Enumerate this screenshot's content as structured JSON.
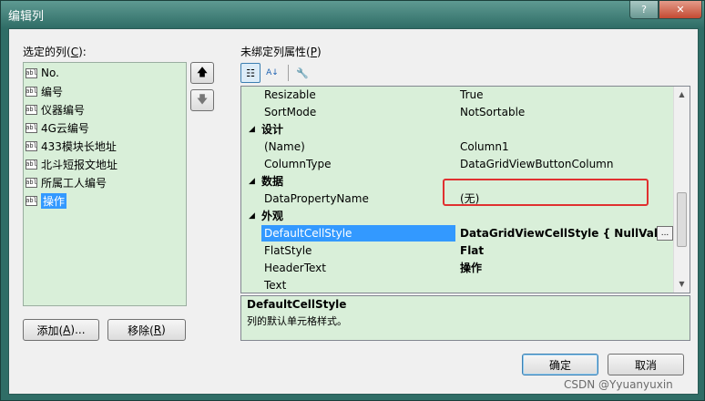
{
  "window": {
    "title": "编辑列",
    "help_glyph": "?",
    "close_glyph": "✕"
  },
  "left": {
    "label": "选定的列(",
    "label_mnemonic": "C",
    "label_suffix": "):",
    "icon_text": "abl",
    "items": [
      "No.",
      "编号",
      "仪器编号",
      "4G云编号",
      "433模块长地址",
      "北斗短报文地址",
      "所属工人编号",
      "操作"
    ],
    "selected_index": 7,
    "add_label": "添加(",
    "add_mnemonic": "A",
    "add_suffix": ")...",
    "remove_label": "移除(",
    "remove_mnemonic": "R",
    "remove_suffix": ")",
    "up_glyph": "🡅",
    "down_glyph": "🡇"
  },
  "right": {
    "label": "未绑定列属性(",
    "label_mnemonic": "P",
    "label_suffix": ")"
  },
  "toolbar": {
    "categorized_glyph": "☷",
    "alphabetical_glyph": "A↓",
    "property_pages_glyph": "🔧"
  },
  "grid": {
    "rows": [
      {
        "kind": "prop",
        "name": "Resizable",
        "value": "True"
      },
      {
        "kind": "prop",
        "name": "SortMode",
        "value": "NotSortable"
      },
      {
        "kind": "cat",
        "name": "设计"
      },
      {
        "kind": "prop",
        "name": "(Name)",
        "value": "Column1"
      },
      {
        "kind": "prop",
        "name": "ColumnType",
        "value": "DataGridViewButtonColumn"
      },
      {
        "kind": "cat",
        "name": "数据"
      },
      {
        "kind": "prop",
        "name": "DataPropertyName",
        "value": "(无)"
      },
      {
        "kind": "cat",
        "name": "外观"
      },
      {
        "kind": "prop",
        "name": "DefaultCellStyle",
        "value": "DataGridViewCellStyle { NullValue=",
        "selected": true,
        "bold": true
      },
      {
        "kind": "prop",
        "name": "FlatStyle",
        "value": "Flat",
        "bold": true
      },
      {
        "kind": "prop",
        "name": "HeaderText",
        "value": "操作",
        "bold": true
      },
      {
        "kind": "prop",
        "name": "Text",
        "value": ""
      }
    ],
    "category_toggle_glyph": "◢",
    "ellipsis_glyph": "...",
    "scroll_up_glyph": "▲",
    "scroll_down_glyph": "▼"
  },
  "description": {
    "title": "DefaultCellStyle",
    "text": "列的默认单元格样式。"
  },
  "footer": {
    "ok_label": "确定",
    "cancel_label": "取消"
  },
  "watermark": "CSDN @Yyuanyuxin",
  "colors": {
    "accent": "#3399ff",
    "panel_green": "#d9efd9",
    "highlight_red": "#e03030"
  }
}
